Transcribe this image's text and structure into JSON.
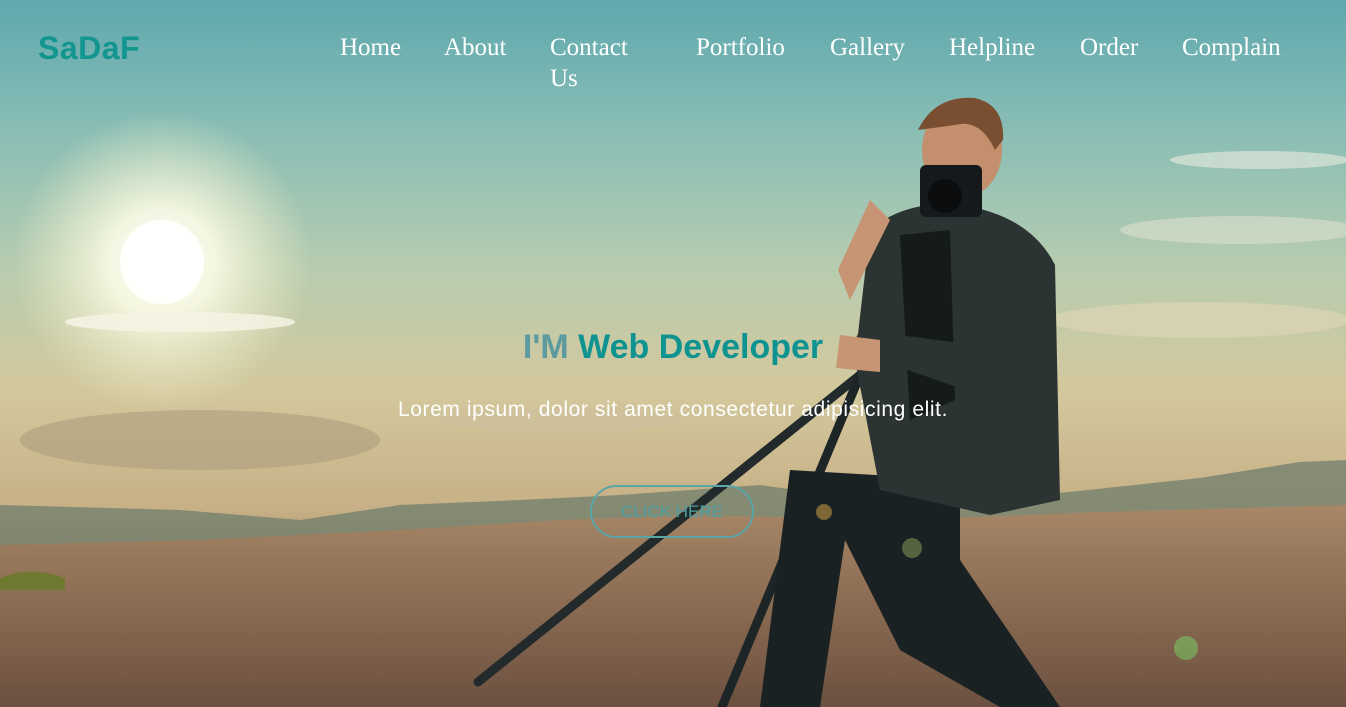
{
  "brand": {
    "logo_text": "SaDaF"
  },
  "nav": {
    "items": [
      {
        "label": "Home"
      },
      {
        "label": "About"
      },
      {
        "label": "Contact Us"
      },
      {
        "label": "Portfolio"
      },
      {
        "label": "Gallery"
      },
      {
        "label": "Helpline"
      },
      {
        "label": "Order"
      },
      {
        "label": "Complain"
      }
    ]
  },
  "hero": {
    "headline_prefix": "I'M",
    "headline_main": "Web Developer",
    "tagline": "Lorem ipsum, dolor sit amet consectetur adipisicing elit.",
    "cta_label": "Click here",
    "background_image": "photographer-with-camera-and-tripod-at-sunset"
  },
  "colors": {
    "brand_teal": "#139590",
    "headline_prefix": "#5c9aa0",
    "nav_text": "#ffffff",
    "button_border": "#5aa5a6"
  }
}
